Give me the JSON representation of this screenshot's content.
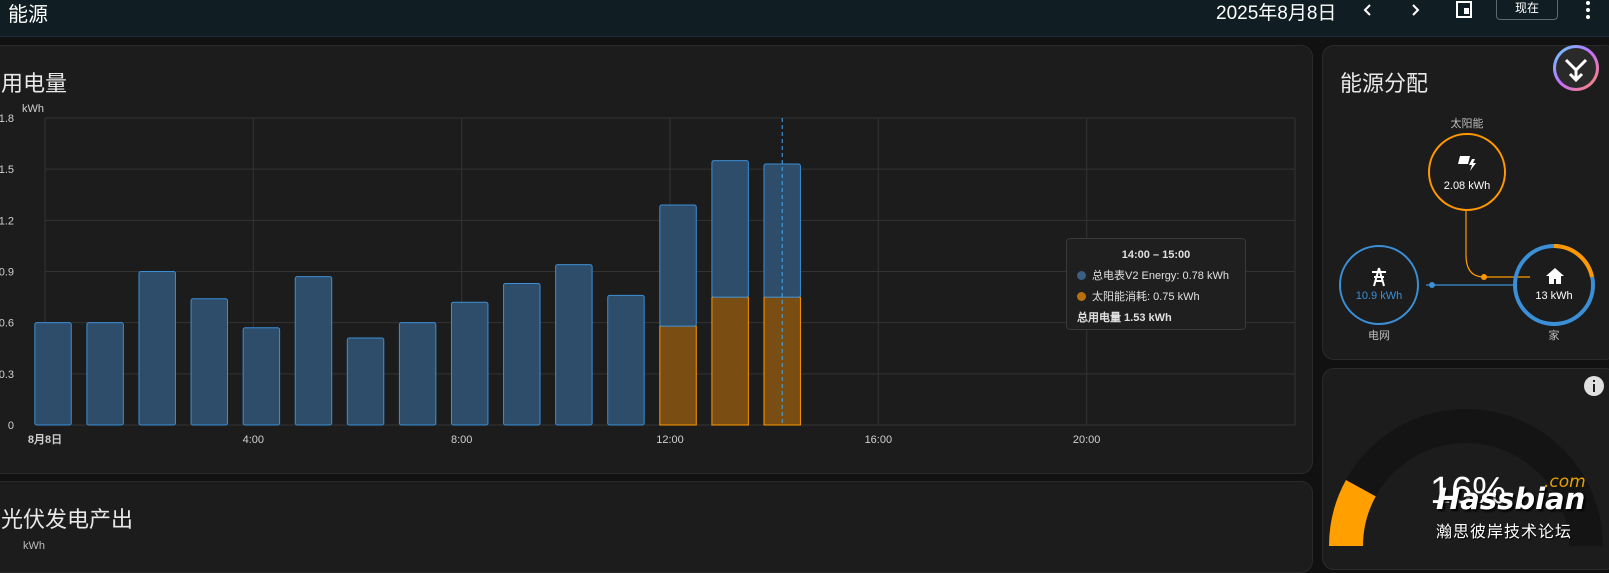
{
  "header": {
    "title": "能源",
    "date": "2025年8月8日",
    "now_label": "现在"
  },
  "usage_card": {
    "title": "用电量",
    "chart_data": {
      "type": "bar",
      "ylabel": "kWh",
      "ylim": [
        0,
        1.8
      ],
      "yticks": [
        "0",
        "0.3",
        "0.6",
        "0.9",
        "1.2",
        "1.5",
        "1.8"
      ],
      "xticks": [
        "8月8日",
        "4:00",
        "8:00",
        "12:00",
        "16:00",
        "20:00"
      ],
      "categories": [
        "0:00",
        "1:00",
        "2:00",
        "3:00",
        "4:00",
        "5:00",
        "6:00",
        "7:00",
        "8:00",
        "9:00",
        "10:00",
        "11:00",
        "12:00",
        "13:00",
        "14:00"
      ],
      "series": [
        {
          "name": "总电表V2 Energy",
          "values": [
            0.6,
            0.6,
            0.9,
            0.74,
            0.57,
            0.87,
            0.51,
            0.6,
            0.72,
            0.83,
            0.94,
            0.76,
            0.71,
            0.8,
            0.78
          ]
        },
        {
          "name": "太阳能消耗",
          "values": [
            0,
            0,
            0,
            0,
            0,
            0,
            0,
            0,
            0,
            0,
            0,
            0,
            0.58,
            0.75,
            0.75
          ]
        }
      ],
      "colors": {
        "grid": "#1e90ff",
        "solar": "#ff9800"
      },
      "grid": true,
      "cursor_category": "14:00"
    },
    "tooltip": {
      "range": "14:00 – 15:00",
      "grid_line": "总电表V2 Energy: 0.78 kWh",
      "solar_line": "太阳能消耗: 0.75 kWh",
      "total_line": "总用电量 1.53 kWh"
    }
  },
  "solar_card": {
    "title": "光伏发电产出",
    "unit": "kWh"
  },
  "distribution": {
    "title": "能源分配",
    "solar": {
      "label": "太阳能",
      "value": "2.08 kWh"
    },
    "grid": {
      "label": "电网",
      "value": "10.9 kWh"
    },
    "home": {
      "label": "家",
      "value": "13 kWh"
    },
    "colors": {
      "solar": "#ff9800",
      "grid": "#3b8fd6",
      "home": "#3b8fd6"
    }
  },
  "gauge": {
    "value_text": "16%",
    "percent": 16,
    "color": "#ff9f00"
  },
  "watermark": {
    "brand": "Hassbian",
    "suffix": ".com",
    "tagline": "瀚思彼岸技术论坛"
  }
}
